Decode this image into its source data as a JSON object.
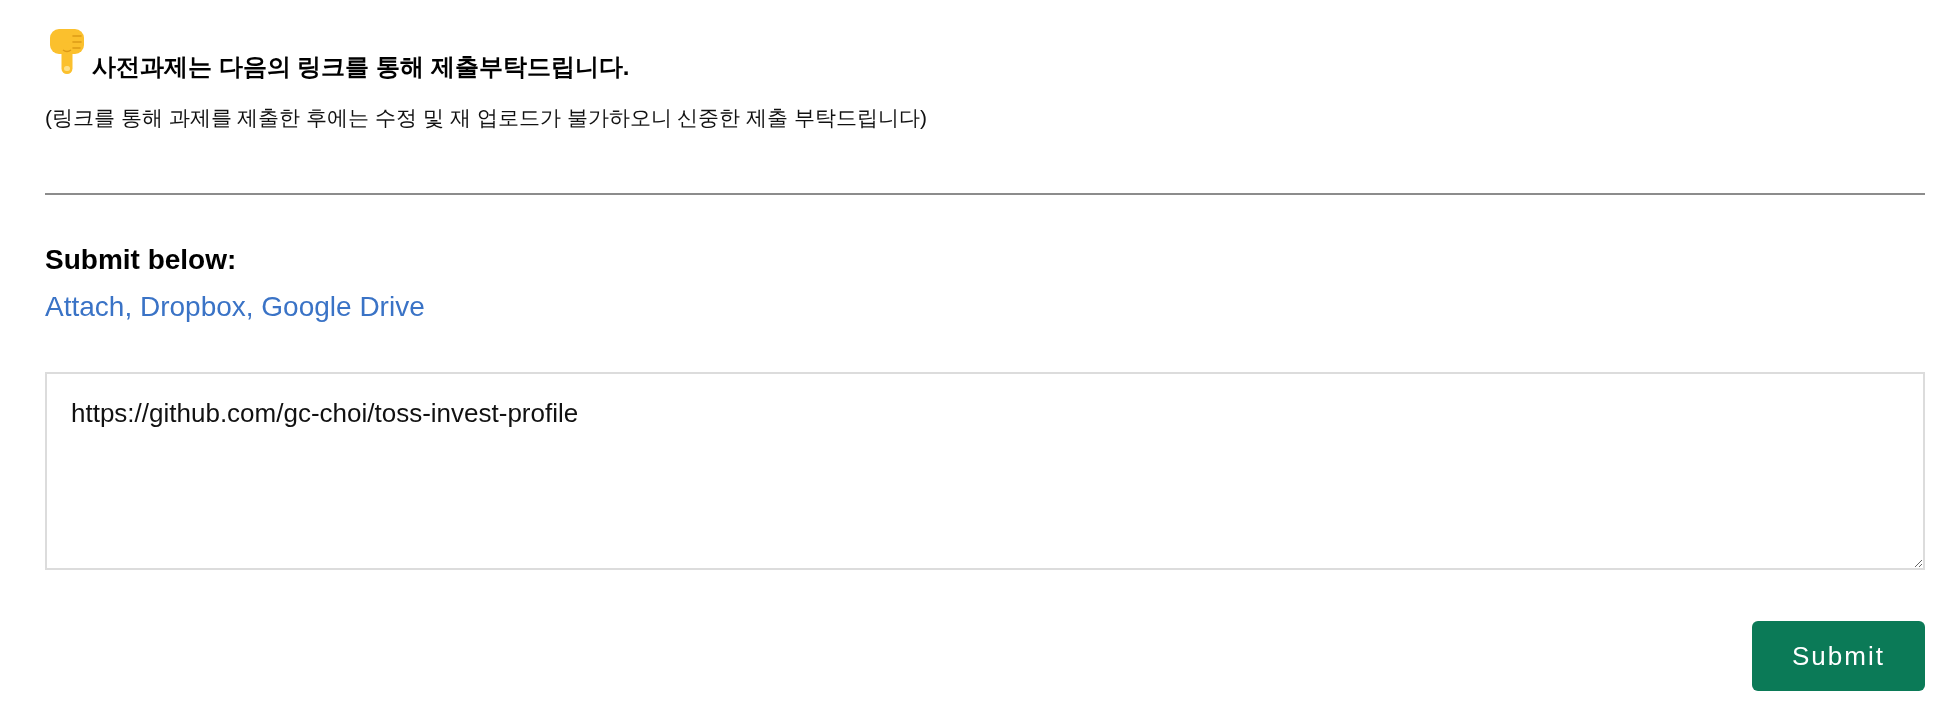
{
  "instruction": {
    "title": "사전과제는 다음의 링크를 통해 제출부탁드립니다.",
    "note": "(링크를 통해 과제를 제출한 후에는 수정 및 재 업로드가 불가하오니 신중한 제출 부탁드립니다)"
  },
  "submission": {
    "label": "Submit below:",
    "link": "Attach, Dropbox, Google Drive",
    "value": "https://github.com/gc-choi/toss-invest-profile"
  },
  "submit_button": {
    "label": "Submit"
  }
}
